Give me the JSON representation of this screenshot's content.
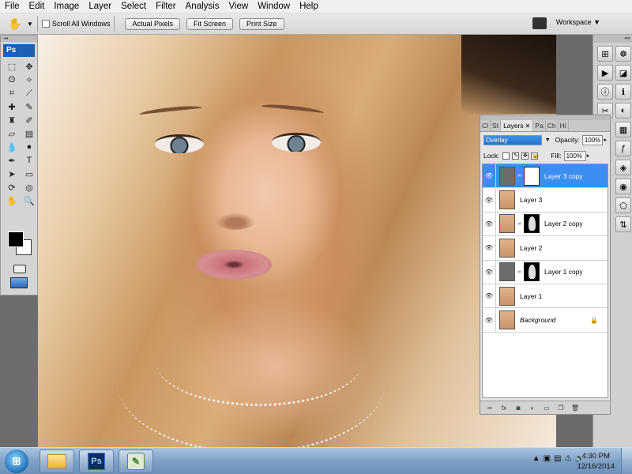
{
  "menu": [
    "File",
    "Edit",
    "Image",
    "Layer",
    "Select",
    "Filter",
    "Analysis",
    "View",
    "Window",
    "Help"
  ],
  "options_bar": {
    "scroll_all_label": "Scroll All Windows",
    "actual_pixels": "Actual Pixels",
    "fit_screen": "Fit Screen",
    "print_size": "Print Size",
    "workspace": "Workspace ▼"
  },
  "toolbox": {
    "logo": "Ps",
    "tools": [
      "marquee",
      "move",
      "lasso",
      "magic-wand",
      "crop",
      "eyedropper",
      "healing",
      "brush",
      "clone-stamp",
      "history-brush",
      "eraser",
      "gradient",
      "blur",
      "dodge",
      "pen",
      "type",
      "path-select",
      "shape",
      "3d-rotate",
      "3d-orbit",
      "hand",
      "zoom"
    ],
    "colors": {
      "foreground": "#000000",
      "background": "#ffffff"
    }
  },
  "layers_panel": {
    "tabs": [
      "Cl",
      "St",
      "Layers",
      "Pa",
      "Ch",
      "Hi"
    ],
    "active_tab": "Layers",
    "blend_mode": "Overlay",
    "opacity_label": "Opacity:",
    "opacity": "100%",
    "lock_label": "Lock:",
    "fill_label": "Fill:",
    "fill": "100%",
    "layers": [
      {
        "name": "Layer 3 copy",
        "selected": true,
        "thumb": "gray",
        "mask": "white"
      },
      {
        "name": "Layer 3",
        "selected": false,
        "thumb": "face",
        "mask": ""
      },
      {
        "name": "Layer 2 copy",
        "selected": false,
        "thumb": "face",
        "mask": "figure"
      },
      {
        "name": "Layer 2",
        "selected": false,
        "thumb": "face",
        "mask": ""
      },
      {
        "name": "Layer 1 copy",
        "selected": false,
        "thumb": "gray",
        "mask": "figure"
      },
      {
        "name": "Layer 1",
        "selected": false,
        "thumb": "face",
        "mask": ""
      },
      {
        "name": "Background",
        "selected": false,
        "thumb": "face",
        "mask": "",
        "locked": true
      }
    ],
    "bottom_icons": [
      "link-icon",
      "fx-icon",
      "mask-icon",
      "adjustment-icon",
      "group-icon",
      "new-layer-icon",
      "trash-icon"
    ]
  },
  "taskbar": {
    "time": "4:30 PM",
    "date": "12/16/2014",
    "apps": [
      "explorer",
      "photoshop",
      "app"
    ]
  },
  "colors": {
    "selection": "#3b8df2",
    "panel_bg": "#e4e4e4",
    "taskbar": "#7fa1c6"
  }
}
